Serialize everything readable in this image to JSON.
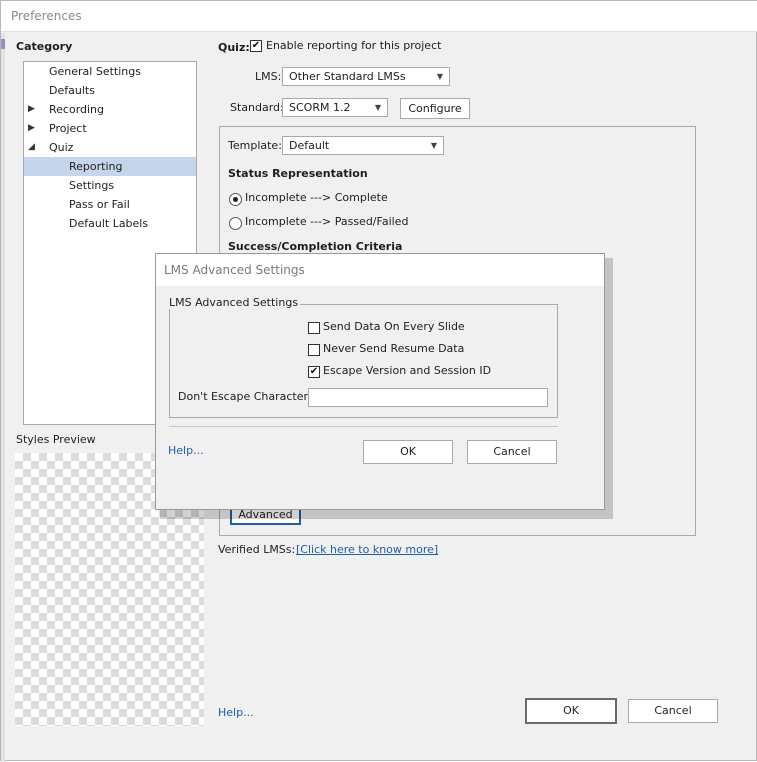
{
  "window": {
    "title": "Preferences"
  },
  "category": {
    "heading": "Category",
    "items": [
      {
        "label": "General Settings",
        "arrow": ""
      },
      {
        "label": "Defaults",
        "arrow": ""
      },
      {
        "label": "Recording",
        "arrow": "▶"
      },
      {
        "label": "Project",
        "arrow": "▶"
      },
      {
        "label": "Quiz",
        "arrow": "◢"
      },
      {
        "label": "Reporting",
        "arrow": ""
      },
      {
        "label": "Settings",
        "arrow": ""
      },
      {
        "label": "Pass or Fail",
        "arrow": ""
      },
      {
        "label": "Default Labels",
        "arrow": ""
      }
    ],
    "selected": "Reporting"
  },
  "styles_preview": {
    "label": "Styles Preview"
  },
  "quiz": {
    "label": "Quiz:",
    "enable_checked": true,
    "enable_label": "Enable reporting for this project"
  },
  "lms": {
    "label": "LMS:",
    "value": "Other Standard LMSs"
  },
  "standard": {
    "label": "Standard:",
    "value": "SCORM 1.2",
    "configure_label": "Configure"
  },
  "template": {
    "label": "Template:",
    "value": "Default"
  },
  "status_representation": {
    "heading": "Status Representation",
    "options": [
      {
        "label": "Incomplete ---> Complete",
        "selected": true
      },
      {
        "label": "Incomplete ---> Passed/Failed",
        "selected": false
      }
    ]
  },
  "success_completion": {
    "heading": "Success/Completion Criteria"
  },
  "advanced_button": "Advanced",
  "verified_lms": {
    "label": "Verified LMSs:",
    "link": "[Click here to know more]"
  },
  "footer": {
    "help": "Help...",
    "ok": "OK",
    "cancel": "Cancel"
  },
  "dialog": {
    "title": "LMS Advanced Settings",
    "group_label": "LMS Advanced Settings",
    "options": [
      {
        "label": "Send Data On Every Slide",
        "checked": false
      },
      {
        "label": "Never Send Resume Data",
        "checked": false
      },
      {
        "label": "Escape Version and Session ID",
        "checked": true
      }
    ],
    "escape_label": "Don't Escape Characters:",
    "escape_value": "",
    "help": "Help...",
    "ok": "OK",
    "cancel": "Cancel"
  },
  "icons": {
    "check": "✔",
    "caret": "▼"
  }
}
